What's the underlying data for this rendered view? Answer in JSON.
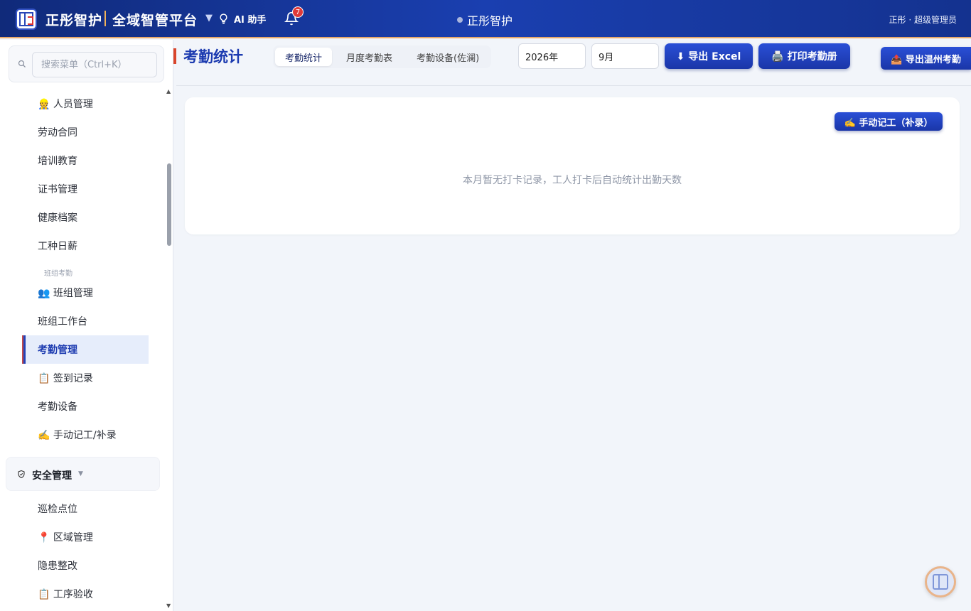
{
  "header": {
    "brand": "正彤智护",
    "platform": "全域智管平台",
    "dropdown_caret": "▼",
    "ai_label": "AI 助手",
    "notification_count": "7",
    "center_title": "正彤智护",
    "user_info": "正彤 · 超级管理员"
  },
  "sidebar": {
    "search_placeholder": "搜索菜单（Ctrl+K）",
    "items": [
      {
        "label": "👷 人员管理"
      },
      {
        "label": "劳动合同"
      },
      {
        "label": "培训教育"
      },
      {
        "label": "证书管理"
      },
      {
        "label": "健康档案"
      },
      {
        "label": "工种日薪"
      }
    ],
    "subheading": "班组考勤",
    "items2": [
      {
        "label": "👥 班组管理"
      },
      {
        "label": "班组工作台"
      },
      {
        "label": "考勤管理"
      },
      {
        "label": "📋 签到记录"
      },
      {
        "label": "考勤设备"
      },
      {
        "label": "✍️ 手动记工/补录"
      }
    ],
    "group_label": "安全管理",
    "group_caret": "▼",
    "items3": [
      {
        "label": "巡检点位"
      },
      {
        "label": "📍 区域管理"
      },
      {
        "label": "隐患整改"
      },
      {
        "label": "📋 工序验收"
      }
    ]
  },
  "main": {
    "title": "考勤统计",
    "tabs": [
      {
        "label": "考勤统计"
      },
      {
        "label": "月度考勤表"
      },
      {
        "label": "考勤设备(佐澜)"
      }
    ],
    "year": "2026年",
    "month": "9月",
    "export_excel": "⬇ 导出 Excel",
    "print_roster": "🖨️ 打印考勤册",
    "export_wenzhou": "📤 导出温州考勤",
    "manual_button": "✍️ 手动记工（补录）",
    "empty_message": "本月暂无打卡记录，工人打卡后自动统计出勤天数"
  },
  "colors": {
    "primary": "#1c3bb0",
    "header_bg": "#1a3fb0",
    "accent_orange": "#f0b25a",
    "badge_red": "#e03a3a"
  }
}
